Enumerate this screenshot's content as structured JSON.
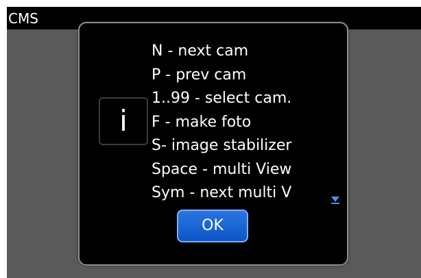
{
  "app": {
    "title": "CMS"
  },
  "dialog": {
    "icon": {
      "name": "info-icon",
      "glyph": "i"
    },
    "lines": [
      "N - next cam",
      "P - prev cam",
      "1..99 - select cam.",
      "F - make foto",
      "S- image stabilizer",
      "Space - multi View",
      "Sym - next multi V"
    ],
    "ok_label": "OK",
    "scroll_indicator": "scroll-down-arrow-icon"
  },
  "colors": {
    "screen_background": "#5a5a5a",
    "dialog_background": "#000000",
    "dialog_border": "#8c8c8c",
    "button_blue": "#1a63d6",
    "button_border": "#7fb0ff",
    "text": "#ffffff"
  }
}
